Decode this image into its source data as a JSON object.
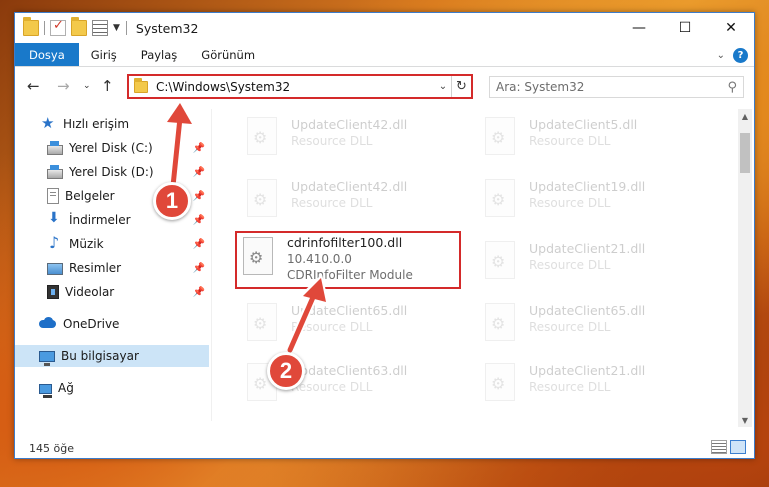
{
  "window": {
    "title": "System32",
    "controls": [
      "—",
      "☐",
      "✕"
    ]
  },
  "ribbon": {
    "tabs": [
      "Dosya",
      "Giriş",
      "Paylaş",
      "Görünüm"
    ]
  },
  "address": {
    "path": "C:\\Windows\\System32",
    "search_placeholder": "Ara: System32"
  },
  "sidebar": {
    "items": [
      {
        "label": "Hızlı erişim",
        "icon": "star-icon"
      },
      {
        "label": "Yerel Disk (C:)",
        "icon": "drive-icon",
        "pinned": true
      },
      {
        "label": "Yerel Disk (D:)",
        "icon": "drive-icon",
        "pinned": true
      },
      {
        "label": "Belgeler",
        "icon": "documents-icon",
        "pinned": true
      },
      {
        "label": "İndirmeler",
        "icon": "download-icon",
        "pinned": true
      },
      {
        "label": "Müzik",
        "icon": "music-icon",
        "pinned": true
      },
      {
        "label": "Resimler",
        "icon": "pictures-icon",
        "pinned": true
      },
      {
        "label": "Videolar",
        "icon": "videos-icon",
        "pinned": true
      },
      {
        "label": "OneDrive",
        "icon": "onedrive-icon"
      },
      {
        "label": "Bu bilgisayar",
        "icon": "this-pc-icon",
        "selected": true
      },
      {
        "label": "Ağ",
        "icon": "network-icon"
      }
    ]
  },
  "files": [
    {
      "name": "UpdateClient42.dll",
      "desc": "Resource DLL"
    },
    {
      "name": "UpdateClient5.dll",
      "desc": "Resource DLL"
    },
    {
      "name": "UpdateClient42.dll",
      "desc": "Resource DLL"
    },
    {
      "name": "UpdateClient19.dll",
      "desc": "Resource DLL"
    },
    {
      "name": "cdrinfofilter100.dll",
      "version": "10.410.0.0",
      "desc": "CDRInfoFilter Module",
      "highlighted": true
    },
    {
      "name": "UpdateClient21.dll",
      "desc": "Resource DLL"
    },
    {
      "name": "UpdateClient65.dll",
      "desc": "Resource DLL"
    },
    {
      "name": "UpdateClient65.dll",
      "desc": "Resource DLL"
    },
    {
      "name": "UpdateClient63.dll",
      "desc": "Resource DLL"
    },
    {
      "name": "UpdateClient21.dll",
      "desc": "Resource DLL"
    }
  ],
  "status": {
    "item_count": "145 öğe"
  },
  "annotations": {
    "step1": "1",
    "step2": "2",
    "color": "#e0483a"
  }
}
